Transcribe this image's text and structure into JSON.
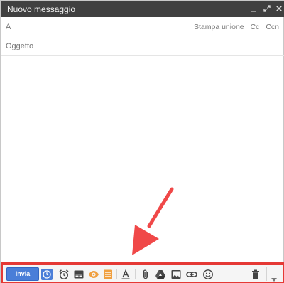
{
  "window": {
    "title": "Nuovo messaggio"
  },
  "recipients": {
    "to_label": "A",
    "links": [
      "Stampa unione",
      "Cc",
      "Ccn"
    ]
  },
  "subject": {
    "placeholder": "Oggetto"
  },
  "toolbar": {
    "send_label": "Invia",
    "icons": [
      "schedule-check-icon",
      "alarm-clock-icon",
      "template-icon",
      "eye-tracking-icon",
      "notes-icon",
      "text-format-icon",
      "attachment-icon",
      "drive-icon",
      "insert-photo-icon",
      "insert-link-icon",
      "emoji-icon",
      "trash-icon",
      "more-options-icon"
    ]
  },
  "colors": {
    "titlebar": "#404040",
    "send_button": "#4a7ed8",
    "highlight": "#e53935",
    "orange_icons": "#f0a040"
  }
}
